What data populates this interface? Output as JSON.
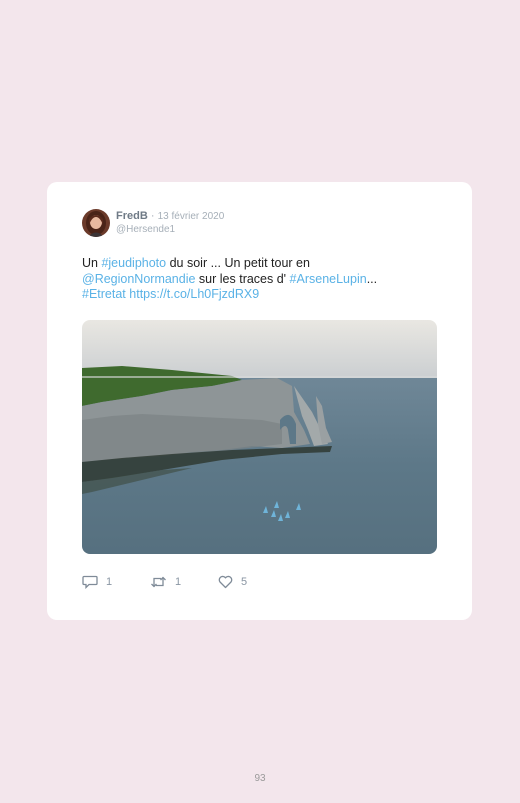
{
  "tweet": {
    "author_name": "FredB",
    "separator": "·",
    "date": "13 février 2020",
    "handle": "@Hersende1",
    "text": {
      "t1": "Un ",
      "l1": "#jeudiphoto",
      "t2": " du soir ... Un petit tour en",
      "l2": "@RegionNormandie",
      "t3": " sur les traces d' ",
      "l3": "#ArseneLupin",
      "t4": "...",
      "l4": "#Etretat",
      "t5": " ",
      "l5": "https://t.co/Lh0FjzdRX9"
    },
    "image_alt": "Falaises d'Étretat au crépuscule",
    "actions": {
      "reply_icon": "reply-icon",
      "reply_count": "1",
      "retweet_icon": "retweet-icon",
      "retweet_count": "1",
      "like_icon": "heart-icon",
      "like_count": "5"
    },
    "colors": {
      "link": "#5ab2e6",
      "background": "#f3e6ec",
      "card": "#ffffff"
    }
  },
  "page_number": "93"
}
